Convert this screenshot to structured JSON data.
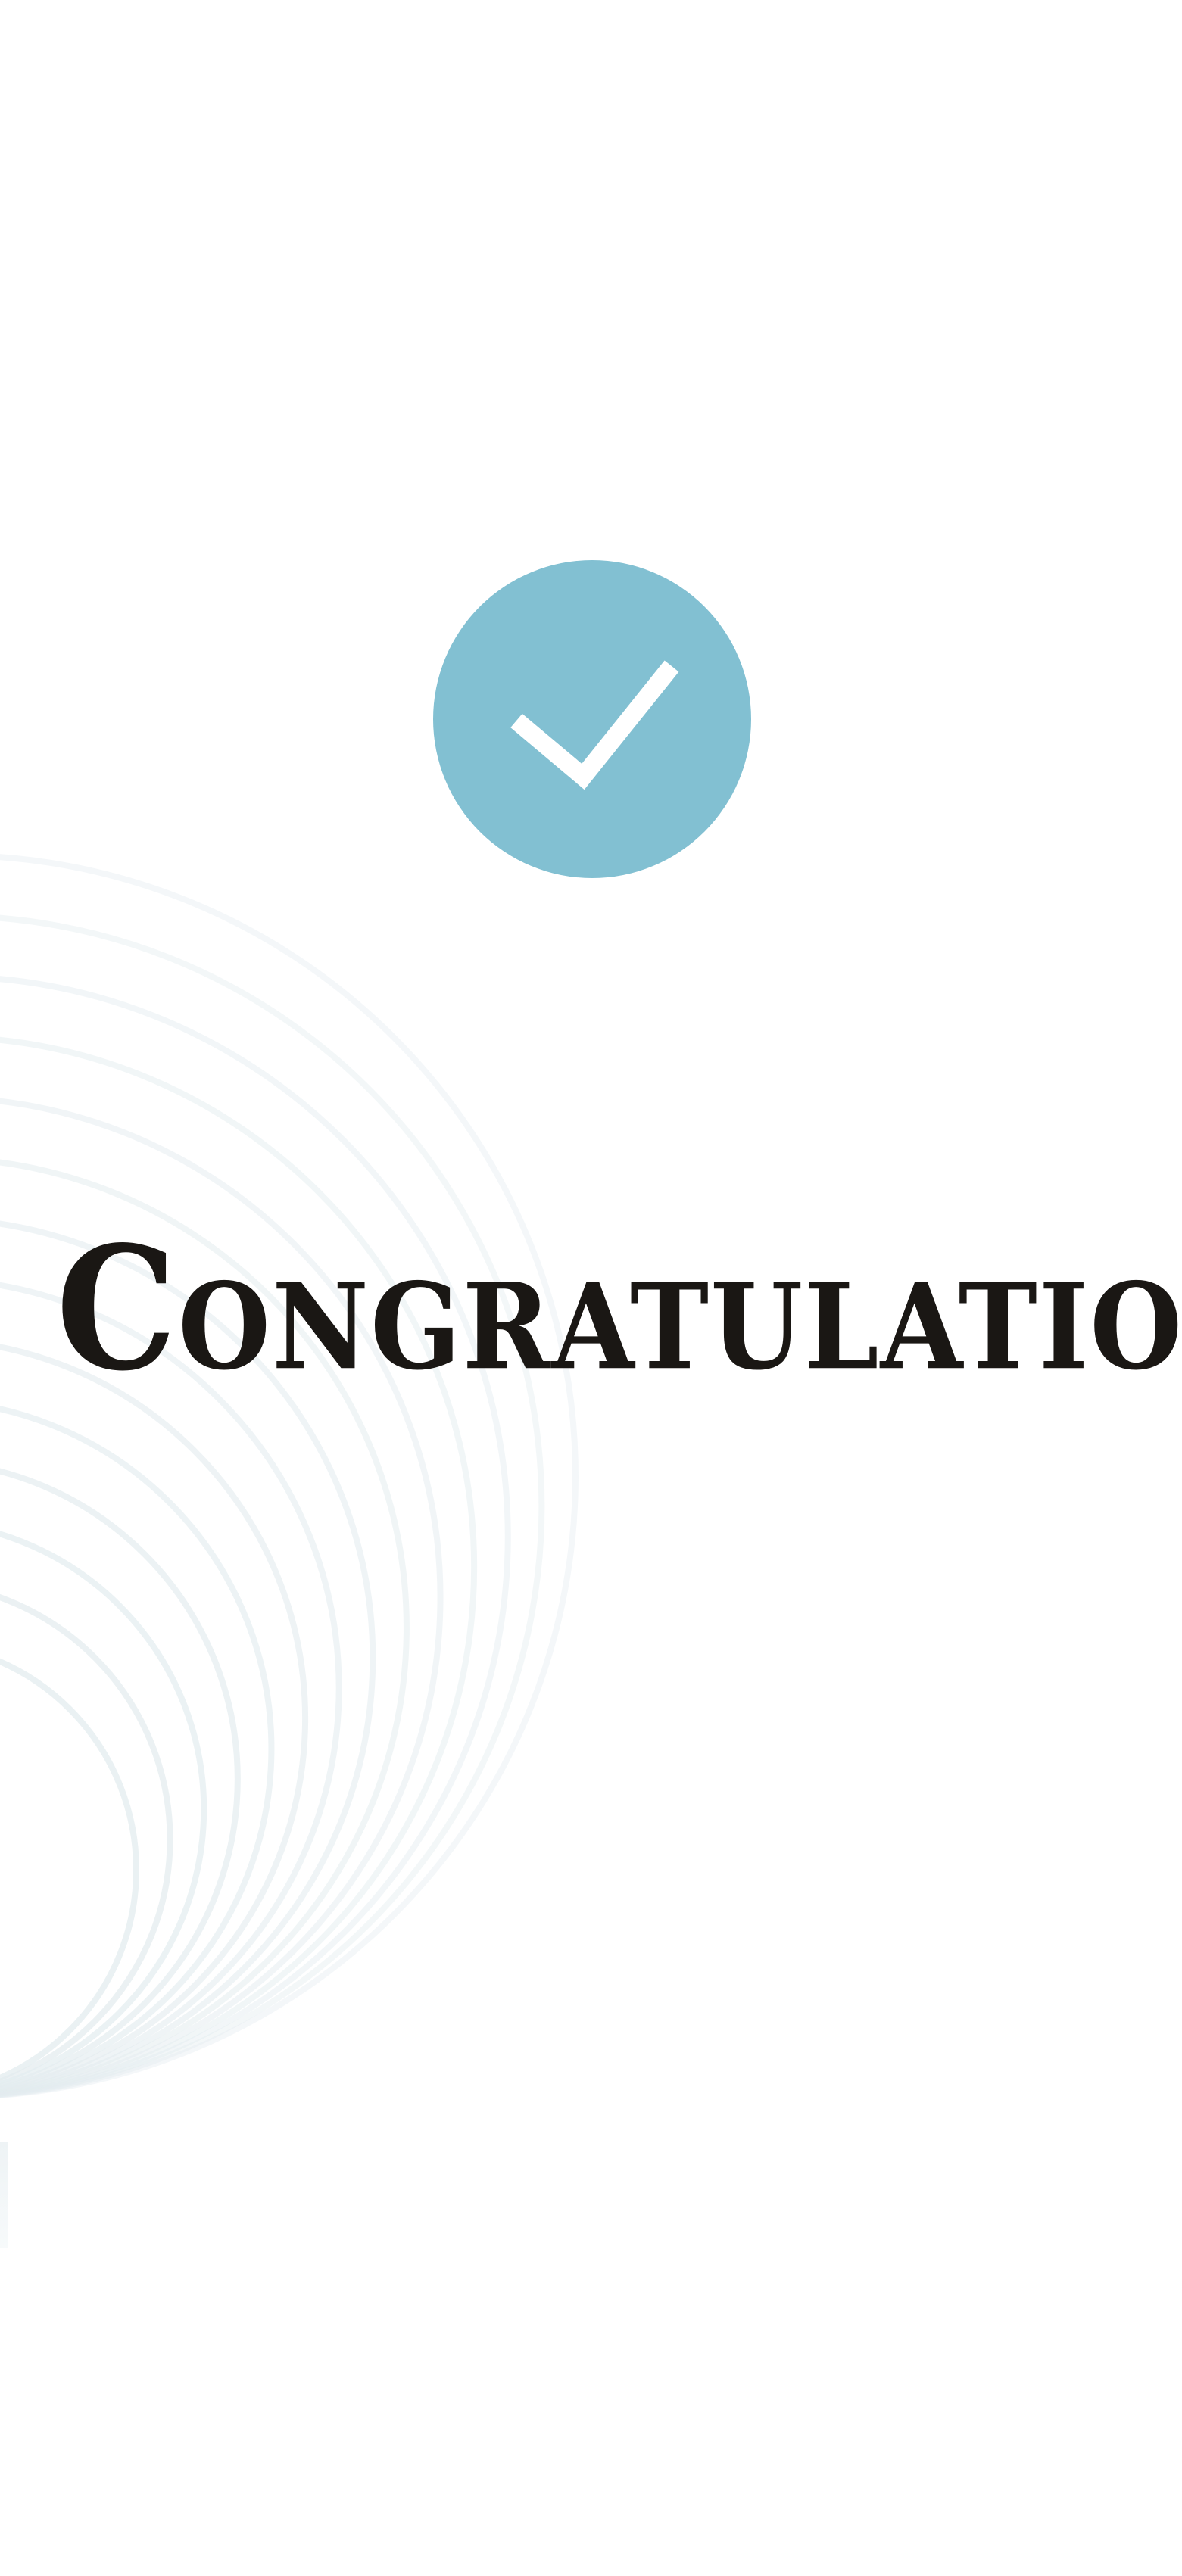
{
  "screen": {
    "title": "Congratulations",
    "icon": "check-circle-icon",
    "colors": {
      "background": "#ffffff",
      "accent": "#82c0d2",
      "check_mark": "#ffffff",
      "title_text": "#1a1714",
      "pattern": "#e3ecef"
    }
  }
}
